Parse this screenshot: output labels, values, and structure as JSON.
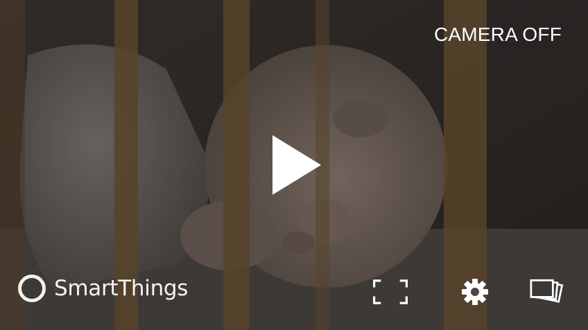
{
  "camera": {
    "status_label": "CAMERA OFF"
  },
  "brand": {
    "name": "SmartThings"
  },
  "controls": {
    "play_icon": "play-icon",
    "fullscreen_icon": "fullscreen-icon",
    "settings_icon": "gear-icon",
    "gallery_icon": "photos-icon"
  },
  "colors": {
    "overlay_text": "#ffffff",
    "crib_bars": "#6b5234"
  }
}
